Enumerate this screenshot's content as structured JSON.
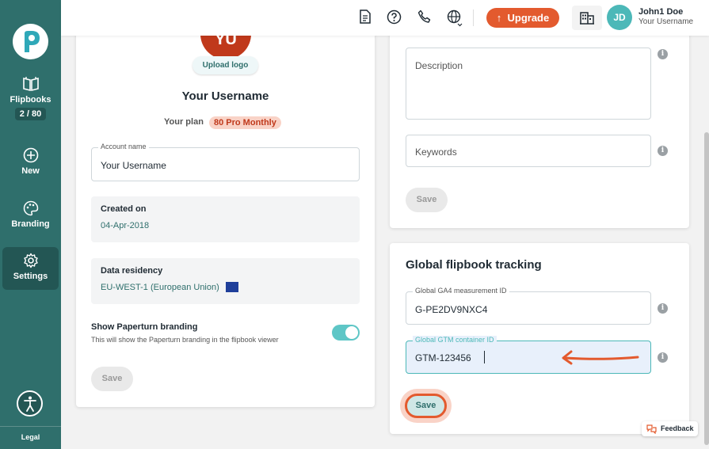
{
  "sidebar": {
    "items": [
      {
        "label": "Flipbooks",
        "badge": "2 / 80",
        "icon": "book-icon"
      },
      {
        "label": "New",
        "icon": "plus-circle-icon"
      },
      {
        "label": "Branding",
        "icon": "palette-icon"
      },
      {
        "label": "Settings",
        "icon": "gear-icon"
      }
    ],
    "legal": "Legal"
  },
  "topbar": {
    "upgrade_label": "Upgrade",
    "avatar_initials": "JD",
    "user_name": "John1 Doe",
    "user_sub": "Your Username"
  },
  "account": {
    "logo_initials": "YU",
    "upload_label": "Upload logo",
    "username": "Your Username",
    "plan_label": "Your plan",
    "plan_value": "80 Pro Monthly",
    "account_name_label": "Account name",
    "account_name_value": "Your Username",
    "created_title": "Created on",
    "created_value": "04-Apr-2018",
    "residency_title": "Data residency",
    "residency_value": "EU-WEST-1 (European Union)",
    "branding_title": "Show Paperturn branding",
    "branding_sub": "This will show the Paperturn branding in the flipbook viewer",
    "branding_enabled": true,
    "save_label": "Save"
  },
  "seo": {
    "description_placeholder": "Description",
    "keywords_placeholder": "Keywords",
    "save_label": "Save"
  },
  "tracking": {
    "title": "Global flipbook tracking",
    "ga4_label": "Global GA4 measurement ID",
    "ga4_value": "G-PE2DV9NXC4",
    "gtm_label": "Global GTM container ID",
    "gtm_value": "GTM-123456",
    "save_label": "Save"
  },
  "feedback_label": "Feedback",
  "colors": {
    "sidebar": "#2f6f6c",
    "accent": "#e35a2e",
    "teal": "#4cb8b8"
  }
}
